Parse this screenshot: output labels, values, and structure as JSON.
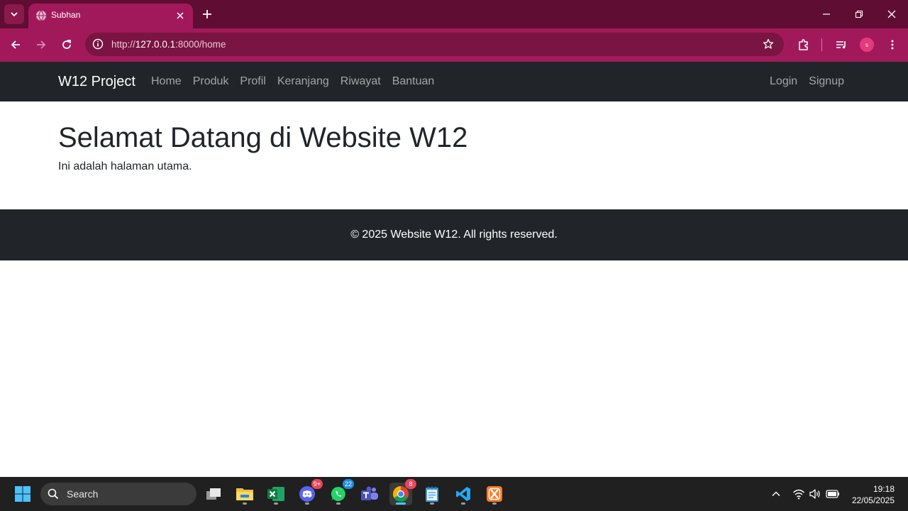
{
  "browser": {
    "tab_title": "Subhan",
    "url_scheme": "http://",
    "url_host": "127.0.0.1",
    "url_rest": ":8000/home",
    "profile_initial": "s",
    "theme_color": "#a2195b"
  },
  "site": {
    "brand": "W12 Project",
    "nav_links": [
      "Home",
      "Produk",
      "Profil",
      "Keranjang",
      "Riwayat",
      "Bantuan"
    ],
    "nav_right": [
      "Login",
      "Signup"
    ],
    "heading": "Selamat Datang di Website W12",
    "intro": "Ini adalah halaman utama.",
    "footer": "© 2025 Website W12. All rights reserved."
  },
  "taskbar": {
    "search_label": "Search",
    "discord_badge": "9+",
    "whatsapp_badge": "22",
    "chrome_badge": "8",
    "time": "19:18",
    "date": "22/05/2025"
  }
}
